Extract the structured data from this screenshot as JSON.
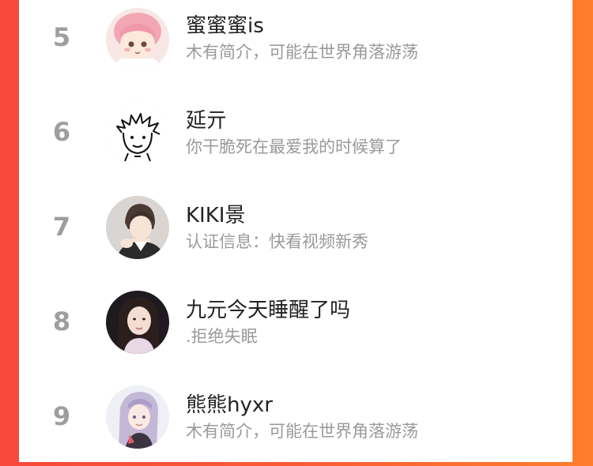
{
  "colors": {
    "background_left": "#f9473c",
    "background_right": "#fd7e2c",
    "rank": "#9e9e9e",
    "name": "#222222",
    "bio": "#9a9a9a"
  },
  "list": {
    "items": [
      {
        "rank": "5",
        "name": "蜜蜜蜜is",
        "bio": "木有简介，可能在世界角落游荡",
        "avatar": "anime-baby-avatar"
      },
      {
        "rank": "6",
        "name": "延亓",
        "bio": "你干脆死在最爱我的时候算了",
        "avatar": "sketch-doodle-avatar"
      },
      {
        "rank": "7",
        "name": "KIKI景",
        "bio": "认证信息：快看视频新秀",
        "avatar": "anime-boy-avatar"
      },
      {
        "rank": "8",
        "name": "九元今天睡醒了吗",
        "bio": ".拒绝失眠",
        "avatar": "girl-photo-avatar"
      },
      {
        "rank": "9",
        "name": "熊熊hyxr",
        "bio": "木有简介，可能在世界角落游荡",
        "avatar": "anime-girl-avatar"
      }
    ]
  }
}
